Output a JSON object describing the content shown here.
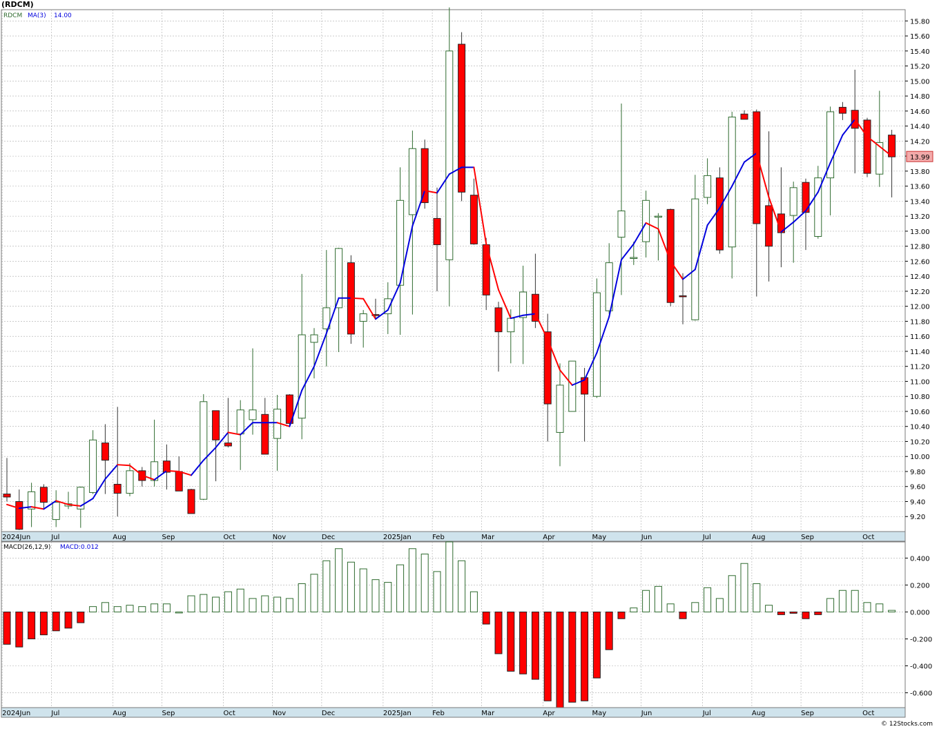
{
  "header": {
    "ticker": "(RDCM)",
    "legend_symbol": "RDCM",
    "legend_ma": "MA(3)",
    "legend_ma_value": "14.00",
    "macd_label": "MACD(26,12,9)",
    "macd_value": "MACD:0.012",
    "last_price": "13.99",
    "watermark": "© 12Stocks.com"
  },
  "colors": {
    "up": "#2d6a2d",
    "down": "#ff0000",
    "ma_up": "#0000dd",
    "ma_down": "#ff0000",
    "grid": "#aaaaaa",
    "axis_strip": "#cfe3ec"
  },
  "chart_data": [
    {
      "type": "candlestick",
      "title": "(RDCM)",
      "yticks": [
        9.2,
        9.4,
        9.6,
        9.8,
        10.0,
        10.2,
        10.4,
        10.6,
        10.8,
        11.0,
        11.2,
        11.4,
        11.6,
        11.8,
        12.0,
        12.2,
        12.4,
        12.6,
        12.8,
        13.0,
        13.2,
        13.4,
        13.6,
        13.8,
        14.0,
        14.2,
        14.4,
        14.6,
        14.8,
        15.0,
        15.2,
        15.4,
        15.6,
        15.8
      ],
      "ylim": [
        9.0,
        15.95
      ],
      "x_labels": [
        "2024Jun",
        "Jul",
        "Aug",
        "Sep",
        "Oct",
        "Nov",
        "Dec",
        "2025Jan",
        "Feb",
        "Mar",
        "Apr",
        "May",
        "Jun",
        "Jul",
        "Aug",
        "Sep",
        "Oct"
      ],
      "x_label_weeks": [
        0,
        4,
        9,
        13,
        18,
        22,
        26,
        31,
        35,
        39,
        44,
        48,
        52,
        57,
        61,
        65,
        70
      ],
      "grid": true,
      "ohlc": [
        [
          9.5,
          9.98,
          9.4,
          9.46
        ],
        [
          9.4,
          9.56,
          9.02,
          9.03
        ],
        [
          9.3,
          9.65,
          9.06,
          9.53
        ],
        [
          9.59,
          9.63,
          9.31,
          9.39
        ],
        [
          9.16,
          9.55,
          9.06,
          9.39
        ],
        [
          9.34,
          9.53,
          9.3,
          9.37
        ],
        [
          9.3,
          9.6,
          9.05,
          9.59
        ],
        [
          9.52,
          10.35,
          9.5,
          10.22
        ],
        [
          10.18,
          10.43,
          9.5,
          9.95
        ],
        [
          9.63,
          10.66,
          9.2,
          9.51
        ],
        [
          9.51,
          9.91,
          9.47,
          9.81
        ],
        [
          9.81,
          9.86,
          9.6,
          9.68
        ],
        [
          9.68,
          10.49,
          9.6,
          9.93
        ],
        [
          9.94,
          10.16,
          9.56,
          9.79
        ],
        [
          9.8,
          10.0,
          9.56,
          9.54
        ],
        [
          9.56,
          9.57,
          9.25,
          9.24
        ],
        [
          9.43,
          10.83,
          9.42,
          10.73
        ],
        [
          10.61,
          10.61,
          9.67,
          10.22
        ],
        [
          10.18,
          10.78,
          10.12,
          10.14
        ],
        [
          10.3,
          10.75,
          9.82,
          10.62
        ],
        [
          10.49,
          11.44,
          10.29,
          10.62
        ],
        [
          10.56,
          10.78,
          10.03,
          10.03
        ],
        [
          10.24,
          10.82,
          9.81,
          10.63
        ],
        [
          10.82,
          10.83,
          10.42,
          10.44
        ],
        [
          10.51,
          12.43,
          10.23,
          11.62
        ],
        [
          11.52,
          11.71,
          11.04,
          11.62
        ],
        [
          11.7,
          12.75,
          11.2,
          11.98
        ],
        [
          11.98,
          12.78,
          11.39,
          12.77
        ],
        [
          12.58,
          12.68,
          11.5,
          11.63
        ],
        [
          11.8,
          11.95,
          11.45,
          11.9
        ],
        [
          11.89,
          12.1,
          11.84,
          11.88
        ],
        [
          11.9,
          12.32,
          11.63,
          12.1
        ],
        [
          12.28,
          13.85,
          11.62,
          13.41
        ],
        [
          13.22,
          14.34,
          11.89,
          14.1
        ],
        [
          14.1,
          14.22,
          13.3,
          13.38
        ],
        [
          13.17,
          13.58,
          12.2,
          12.82
        ],
        [
          12.62,
          15.98,
          12.0,
          15.4
        ],
        [
          15.49,
          15.65,
          13.4,
          13.52
        ],
        [
          13.48,
          13.7,
          12.82,
          12.83
        ],
        [
          12.82,
          12.91,
          11.95,
          12.15
        ],
        [
          11.98,
          12.06,
          11.13,
          11.66
        ],
        [
          11.66,
          11.96,
          11.24,
          11.84
        ],
        [
          11.85,
          12.54,
          11.23,
          12.19
        ],
        [
          12.16,
          12.7,
          11.71,
          11.8
        ],
        [
          11.66,
          11.9,
          10.2,
          10.7
        ],
        [
          10.32,
          11.24,
          9.87,
          10.95
        ],
        [
          10.6,
          11.14,
          10.6,
          11.27
        ],
        [
          11.05,
          11.18,
          10.2,
          10.83
        ],
        [
          10.8,
          12.37,
          10.78,
          12.18
        ],
        [
          11.94,
          12.84,
          11.9,
          12.58
        ],
        [
          12.92,
          14.7,
          12.15,
          13.27
        ],
        [
          12.65,
          12.86,
          12.55,
          12.65
        ],
        [
          12.86,
          13.54,
          12.65,
          13.41
        ],
        [
          13.2,
          13.24,
          12.61,
          13.2
        ],
        [
          13.29,
          13.3,
          12.0,
          12.05
        ],
        [
          12.14,
          12.44,
          11.76,
          12.13
        ],
        [
          11.82,
          13.75,
          11.81,
          13.43
        ],
        [
          13.45,
          13.97,
          13.36,
          13.74
        ],
        [
          13.71,
          13.85,
          12.7,
          12.75
        ],
        [
          12.79,
          14.59,
          12.37,
          14.52
        ],
        [
          14.56,
          14.61,
          14.51,
          14.49
        ],
        [
          14.59,
          14.62,
          12.13,
          13.1
        ],
        [
          13.34,
          14.33,
          12.33,
          12.8
        ],
        [
          13.23,
          13.85,
          12.52,
          12.98
        ],
        [
          13.21,
          13.66,
          12.58,
          13.58
        ],
        [
          13.65,
          13.7,
          12.75,
          13.25
        ],
        [
          12.93,
          13.87,
          12.9,
          13.71
        ],
        [
          13.71,
          14.66,
          13.21,
          14.59
        ],
        [
          14.65,
          14.72,
          14.48,
          14.57
        ],
        [
          14.61,
          15.15,
          13.77,
          14.37
        ],
        [
          14.48,
          14.51,
          13.72,
          13.77
        ],
        [
          13.76,
          14.87,
          13.59,
          14.18
        ],
        [
          14.28,
          14.35,
          13.45,
          13.99
        ]
      ],
      "ma3": [
        9.36,
        9.31,
        9.33,
        9.3,
        9.41,
        9.36,
        9.34,
        9.44,
        9.7,
        9.89,
        9.88,
        9.75,
        9.69,
        9.81,
        9.8,
        9.75,
        9.95,
        10.12,
        10.32,
        10.29,
        10.45,
        10.45,
        10.45,
        10.4,
        10.88,
        11.2,
        11.64,
        12.11,
        12.11,
        12.1,
        11.83,
        11.95,
        12.31,
        13.07,
        13.54,
        13.51,
        13.76,
        13.85,
        13.85,
        12.83,
        12.22,
        11.84,
        11.88,
        11.9,
        11.56,
        11.15,
        10.95,
        11.02,
        11.38,
        11.86,
        12.62,
        12.83,
        13.11,
        13.03,
        12.6,
        12.36,
        12.49,
        13.08,
        13.31,
        13.6,
        13.92,
        14.04,
        13.45,
        12.99,
        13.12,
        13.27,
        13.52,
        13.91,
        14.28,
        14.49,
        14.26,
        14.13,
        14.0
      ]
    },
    {
      "type": "bar",
      "title": "MACD(26,12,9)",
      "yticks": [
        -0.6,
        -0.4,
        -0.2,
        0.0,
        0.2,
        0.4
      ],
      "ylim": [
        -0.71,
        0.52
      ],
      "values": [
        -0.24,
        -0.26,
        -0.2,
        -0.17,
        -0.14,
        -0.12,
        -0.08,
        0.04,
        0.07,
        0.04,
        0.05,
        0.04,
        0.06,
        0.06,
        0.0,
        0.12,
        0.13,
        0.11,
        0.15,
        0.17,
        0.1,
        0.12,
        0.11,
        0.1,
        0.21,
        0.28,
        0.38,
        0.47,
        0.37,
        0.32,
        0.24,
        0.22,
        0.35,
        0.47,
        0.43,
        0.3,
        0.52,
        0.38,
        0.15,
        -0.09,
        -0.31,
        -0.44,
        -0.46,
        -0.5,
        -0.66,
        -0.71,
        -0.67,
        -0.66,
        -0.49,
        -0.28,
        -0.05,
        0.03,
        0.16,
        0.19,
        0.06,
        -0.05,
        0.07,
        0.18,
        0.1,
        0.27,
        0.36,
        0.21,
        0.05,
        -0.02,
        -0.01,
        -0.05,
        -0.02,
        0.1,
        0.16,
        0.16,
        0.07,
        0.06,
        0.012
      ]
    }
  ]
}
